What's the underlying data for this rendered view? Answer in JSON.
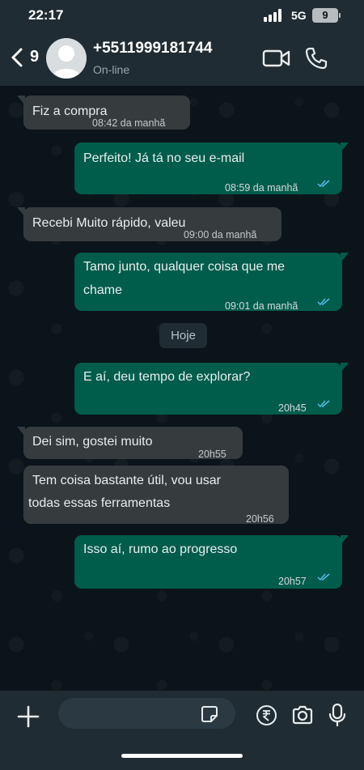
{
  "status_bar": {
    "time": "22:17",
    "network": "5G",
    "battery": "9"
  },
  "header": {
    "back_icon": "chevron-left-icon",
    "unread_count": "9",
    "contact_name": "+5511999181744",
    "contact_status": "On-line",
    "video_icon": "video-camera-icon",
    "call_icon": "phone-icon"
  },
  "date_chip": "Hoje",
  "messages": [
    {
      "direction": "in",
      "text": "Fiz a compra",
      "time": "08:42 da manhã"
    },
    {
      "direction": "out",
      "text": "Perfeito! Já tá no seu e-mail",
      "time": "08:59 da manhã",
      "read": true
    },
    {
      "direction": "in",
      "text": "Recebi Muito rápido, valeu",
      "time": "09:00 da manhã"
    },
    {
      "direction": "out",
      "text_line1": "Tamo junto, qualquer coisa que me",
      "text_line2": "chame",
      "time": "09:01 da manhã",
      "read": true
    },
    {
      "direction": "out",
      "text": "E aí, deu tempo de explorar?",
      "time": "20h45",
      "read": true
    },
    {
      "direction": "in",
      "text": "Dei sim, gostei muito",
      "time": "20h55"
    },
    {
      "direction": "in",
      "text_line1": "Tem coisa bastante útil, vou usar",
      "text_line2": "todas essas ferramentas",
      "time": "20h56"
    },
    {
      "direction": "out",
      "text": "Isso aí, rumo ao progresso",
      "time": "20h57",
      "read": true
    }
  ],
  "colors": {
    "incoming_bubble": "#363b3e",
    "outgoing_bubble": "#005c4b",
    "read_ticks": "#53bdeb",
    "background": "#0b141a"
  },
  "input_bar": {
    "plus_icon": "plus-icon",
    "sticker_icon": "sticker-icon",
    "payment_icon": "rupee-payment-icon",
    "camera_icon": "camera-icon",
    "mic_icon": "microphone-icon"
  }
}
